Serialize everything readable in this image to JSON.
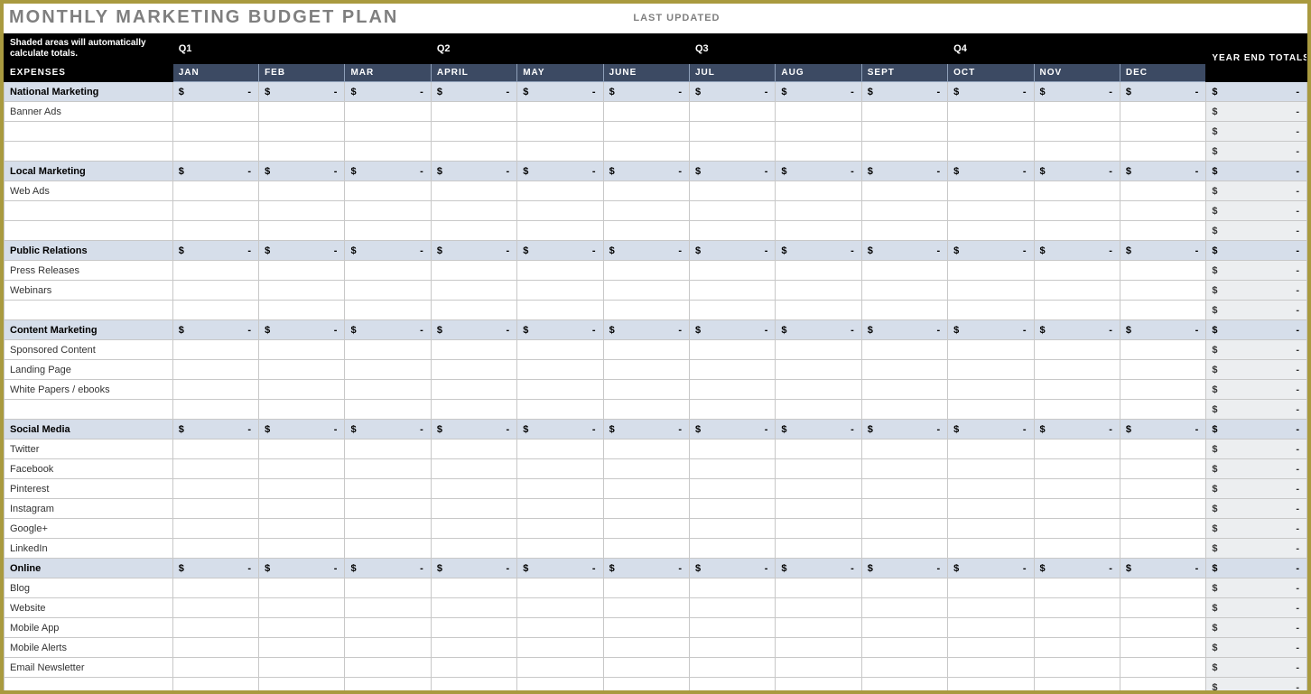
{
  "title": "MONTHLY MARKETING BUDGET PLAN",
  "last_updated_label": "LAST UPDATED",
  "note": "Shaded areas will automatically calculate totals.",
  "expenses_label": "EXPENSES",
  "quarters": [
    "Q1",
    "Q2",
    "Q3",
    "Q4"
  ],
  "months": [
    "JAN",
    "FEB",
    "MAR",
    "APRIL",
    "MAY",
    "JUNE",
    "JUL",
    "AUG",
    "SEPT",
    "OCT",
    "NOV",
    "DEC"
  ],
  "year_end_label": "YEAR END TOTALS",
  "currency_symbol": "$",
  "dash": "-",
  "categories": [
    {
      "name": "National Marketing",
      "show_monthly_totals": true,
      "items": [
        "Banner Ads",
        "",
        ""
      ]
    },
    {
      "name": "Local Marketing",
      "show_monthly_totals": true,
      "items": [
        "Web Ads",
        "",
        ""
      ]
    },
    {
      "name": "Public Relations",
      "show_monthly_totals": true,
      "items": [
        "Press Releases",
        "Webinars",
        ""
      ]
    },
    {
      "name": "Content Marketing",
      "show_monthly_totals": true,
      "items": [
        "Sponsored Content",
        "Landing Page",
        "White Papers / ebooks",
        ""
      ]
    },
    {
      "name": "Social Media",
      "show_monthly_totals": true,
      "items": [
        "Twitter",
        "Facebook",
        "Pinterest",
        "Instagram",
        "Google+",
        "LinkedIn"
      ]
    },
    {
      "name": "Online",
      "show_monthly_totals": true,
      "items": [
        "Blog",
        "Website",
        "Mobile App",
        "Mobile Alerts",
        "Email Newsletter",
        ""
      ]
    }
  ]
}
